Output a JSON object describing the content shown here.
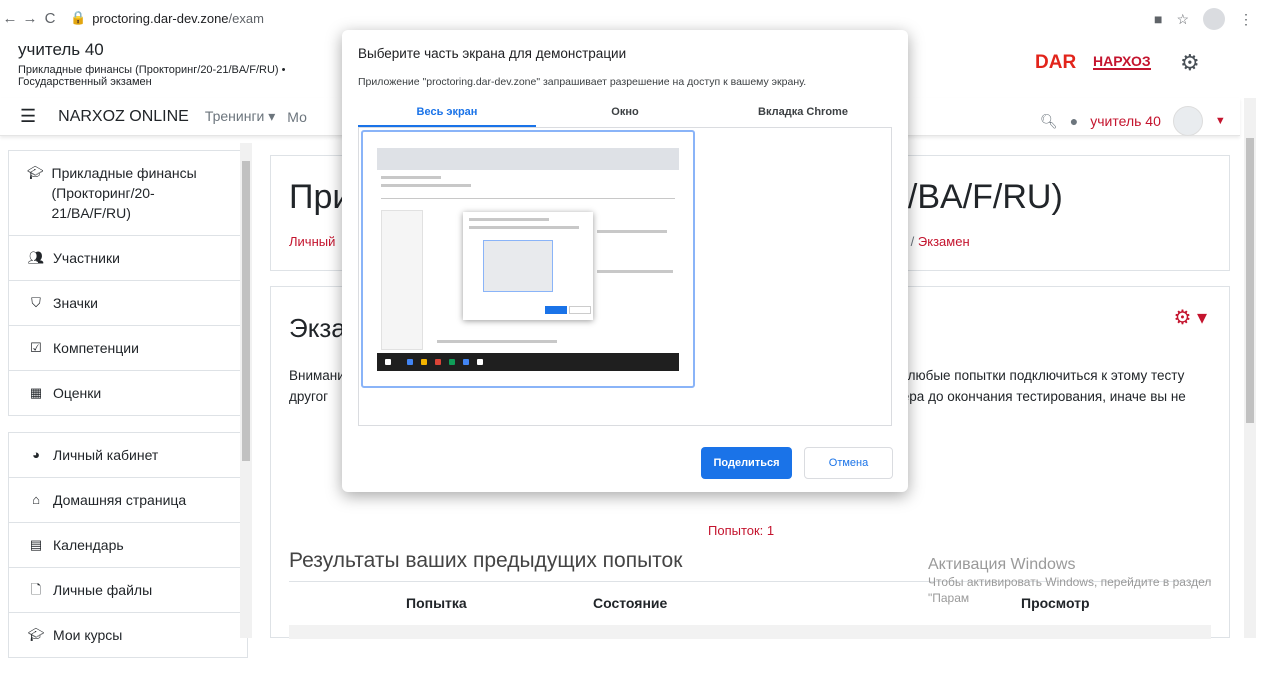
{
  "browser": {
    "url_host": "proctoring.dar-dev.zone",
    "url_path": "/exam"
  },
  "header": {
    "user": "учитель 40",
    "course_line1": "Прикладные финансы (Прокторинг/20-21/BA/F/RU) •",
    "course_line2": "Государственный экзамен",
    "logo_dar": "DAR",
    "logo_narxoz": "НАРХОЗ"
  },
  "navbar": {
    "site_name": "NARXOZ ONLINE",
    "menu_trainings": "Тренинги ▾",
    "menu_more": "Мо",
    "user_name": "учитель 40"
  },
  "sidebar": {
    "group1": [
      {
        "icon": "graduation-cap-icon",
        "label": "Прикладные финансы (Прокторинг/20-21/BA/F/RU)"
      },
      {
        "icon": "users-icon",
        "label": "Участники"
      },
      {
        "icon": "shield-icon",
        "label": "Значки"
      },
      {
        "icon": "checkbox-icon",
        "label": "Компетенции"
      },
      {
        "icon": "table-icon",
        "label": "Оценки"
      }
    ],
    "group2": [
      {
        "icon": "dashboard-icon",
        "label": "Личный кабинет"
      },
      {
        "icon": "home-icon",
        "label": "Домашняя страница"
      },
      {
        "icon": "calendar-icon",
        "label": "Календарь"
      },
      {
        "icon": "file-icon",
        "label": "Личные файлы"
      },
      {
        "icon": "graduation-cap-icon",
        "label": "Мои курсы"
      }
    ]
  },
  "main": {
    "title_left": "При",
    "title_right": "1/BA/F/RU)",
    "breadcrumb_left": "Личный",
    "breadcrumb_right_prefix": "ЕН  /",
    "breadcrumb_current": "Экзамен",
    "quiz_title": "Экза",
    "notice_left": "Внимани с другог",
    "notice_right_1": "ия любые попытки подключиться к этому тесту",
    "notice_right_2": "узера до окончания тестирования, иначе вы не",
    "attempts": "Попыток: 1",
    "prev_results": "Результаты ваших предыдущих попыток",
    "col_attempt": "Попытка",
    "col_state": "Состояние",
    "col_review": "Просмотр"
  },
  "windows_activation": {
    "title": "Активация Windows",
    "text": "Чтобы активировать Windows, перейдите в раздел \"Парам"
  },
  "dialog": {
    "title": "Выберите часть экрана для демонстрации",
    "description": "Приложение \"proctoring.dar-dev.zone\" запрашивает разрешение на доступ к вашему экрану.",
    "tabs": [
      "Весь экран",
      "Окно",
      "Вкладка Chrome"
    ],
    "share_button": "Поделиться",
    "cancel_button": "Отмена"
  },
  "colors": {
    "accent": "#c4142e",
    "chrome_blue": "#1a73e8"
  }
}
